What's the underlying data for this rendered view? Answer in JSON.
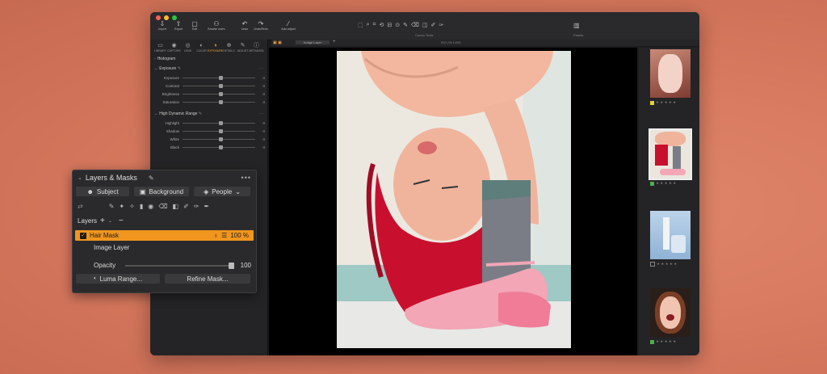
{
  "toolbar": {
    "left_buttons": [
      {
        "label": "Import",
        "icon": "import-icon",
        "glyph": "⇩"
      },
      {
        "label": "Export",
        "icon": "export-icon",
        "glyph": "⇧"
      },
      {
        "label": "Edit",
        "icon": "edit-icon",
        "glyph": "▢"
      }
    ],
    "browse_users_label": "Browse users",
    "undo_label": "Undo",
    "redo_label": "Redo",
    "undo_group_label": "Undo/Redo",
    "auto_adjust_label": "Auto adjust",
    "cursor_tools_label": "Cursor Tools",
    "panels_label": "Panels"
  },
  "tool_tabs": [
    {
      "label": "LIBRARY",
      "glyph": "▭"
    },
    {
      "label": "CAPTURE",
      "glyph": "◉"
    },
    {
      "label": "LENS",
      "glyph": "◎"
    },
    {
      "label": "COLOR",
      "glyph": "◐"
    },
    {
      "label": "EXPOSURE",
      "glyph": "◑"
    },
    {
      "label": "DETAILS",
      "glyph": "⊕"
    },
    {
      "label": "ADJUST",
      "glyph": "✎"
    },
    {
      "label": "METADATA",
      "glyph": "ⓘ"
    }
  ],
  "left_panel": {
    "histogram_label": "Histogram",
    "exposure_label": "Exposure",
    "exposure_rows": [
      {
        "label": "Exposure",
        "value": "0"
      },
      {
        "label": "Contrast",
        "value": "0"
      },
      {
        "label": "Brightness",
        "value": "0"
      },
      {
        "label": "Saturation",
        "value": "0"
      }
    ],
    "hdr_label": "High Dynamic Range",
    "hdr_rows": [
      {
        "label": "Highlight",
        "value": "0"
      },
      {
        "label": "Shadow",
        "value": "0"
      },
      {
        "label": "White",
        "value": "0"
      },
      {
        "label": "Black",
        "value": "0"
      }
    ]
  },
  "tab_strip": {
    "layer_select": "Image Layer",
    "readout": "ISO  ƒ/8  1/250"
  },
  "layers_masks": {
    "title": "Layers & Masks",
    "subject_label": "Subject",
    "background_label": "Background",
    "people_label": "People",
    "layers_label": "Layers",
    "hair_mask_label": "Hair Mask",
    "hair_mask_opacity": "100 %",
    "image_layer_label": "Image Layer",
    "opacity_label": "Opacity",
    "opacity_value": "100",
    "luma_range_label": "Luma Range...",
    "refine_mask_label": "Refine Mask..."
  },
  "filmstrip": [
    {
      "tag_color": "#e2d13a",
      "stars": "★ ★ ★ ★ ★"
    },
    {
      "tag_color": "#4caf50",
      "stars": "★ ★ ★ ★ ★"
    },
    {
      "tag_color": "#888888",
      "stars": "★ ★ ★ ★ ★"
    },
    {
      "tag_color": "#4caf50",
      "stars": "★ ★ ★ ★ ★"
    }
  ],
  "colors": {
    "accent": "#f0961e",
    "mask_red": "#c8102e",
    "background": "#d87a60"
  }
}
